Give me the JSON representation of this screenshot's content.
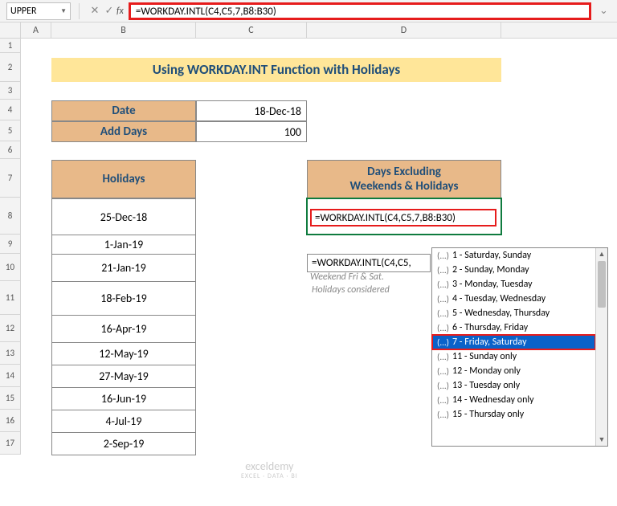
{
  "nameBox": "UPPER",
  "formulaBar": "=WORKDAY.INTL(C4,C5,7,B8:B30)",
  "cols": [
    "A",
    "B",
    "C",
    "D"
  ],
  "rowNums": [
    "1",
    "2",
    "3",
    "4",
    "5",
    "6",
    "7",
    "8",
    "9",
    "10",
    "11",
    "12",
    "13",
    "14",
    "15",
    "16",
    "17"
  ],
  "title": "Using WORKDAY.INT Function with Holidays",
  "labels": {
    "date": "Date",
    "addDays": "Add Days",
    "holidays": "Holidays",
    "daysEx": "Days Excluding\nWeekends & Holidays"
  },
  "vals": {
    "date": "18-Dec-18",
    "addDays": "100"
  },
  "holidays": [
    "25-Dec-18",
    "1-Jan-19",
    "21-Jan-19",
    "18-Feb-19",
    "16-Apr-19",
    "12-May-19",
    "27-May-19",
    "16-Jun-19",
    "4-Jul-19",
    "2-Sep-19"
  ],
  "activeFormula": "=WORKDAY.INTL(C4,C5,7,B8:B30)",
  "partialFormula": "=WORKDAY.INTL(C4,C5,",
  "note1": "Weekend Fri & Sat.",
  "note2": "Holidays considered",
  "autocomplete": [
    {
      "code": "1",
      "label": "Saturday, Sunday",
      "sel": false
    },
    {
      "code": "2",
      "label": "Sunday, Monday",
      "sel": false
    },
    {
      "code": "3",
      "label": "Monday, Tuesday",
      "sel": false
    },
    {
      "code": "4",
      "label": "Tuesday, Wednesday",
      "sel": false
    },
    {
      "code": "5",
      "label": "Wednesday, Thursday",
      "sel": false
    },
    {
      "code": "6",
      "label": "Thursday, Friday",
      "sel": false
    },
    {
      "code": "7",
      "label": "Friday, Saturday",
      "sel": true
    },
    {
      "code": "11",
      "label": "Sunday only",
      "sel": false
    },
    {
      "code": "12",
      "label": "Monday only",
      "sel": false
    },
    {
      "code": "13",
      "label": "Tuesday only",
      "sel": false
    },
    {
      "code": "14",
      "label": "Wednesday only",
      "sel": false
    },
    {
      "code": "15",
      "label": "Thursday only",
      "sel": false
    }
  ],
  "watermark": {
    "main": "exceldemy",
    "sub": "EXCEL · DATA · BI"
  }
}
